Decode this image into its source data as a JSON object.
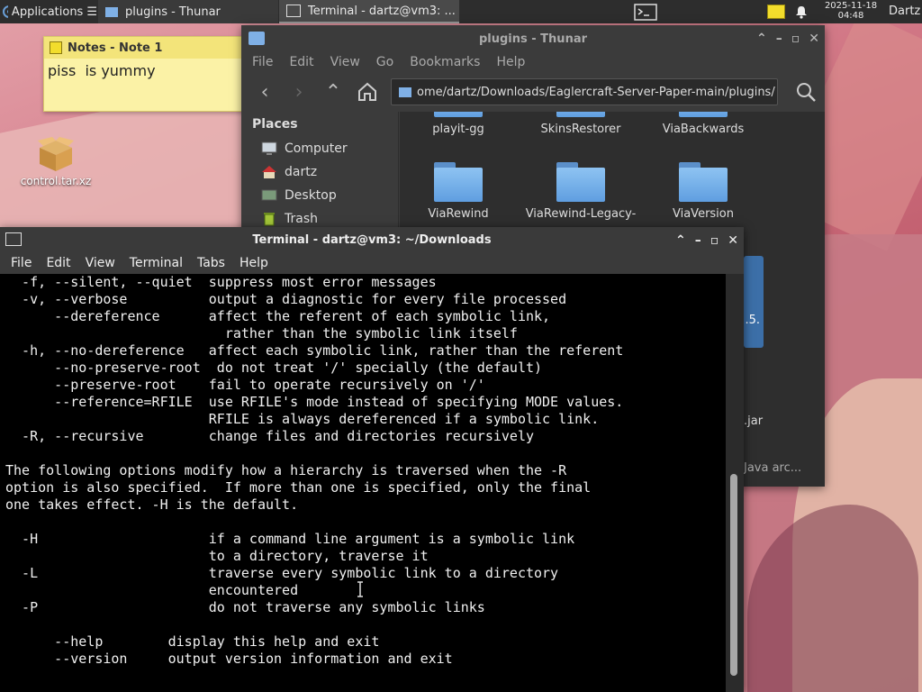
{
  "panel": {
    "apps_label": "Applications",
    "tasks": [
      {
        "label": "plugins - Thunar"
      },
      {
        "label": "Terminal - dartz@vm3: ..."
      }
    ],
    "clock_date": "2025-11-18",
    "clock_time": "04:48",
    "user": "Dartz"
  },
  "note": {
    "title": "Notes - Note 1",
    "body": "piss  is yummy"
  },
  "desktop_icons": [
    {
      "label": "control.tar.xz",
      "icon": "archive-icon"
    }
  ],
  "thunar": {
    "title": "plugins - Thunar",
    "menu": [
      "File",
      "Edit",
      "View",
      "Go",
      "Bookmarks",
      "Help"
    ],
    "path": "ome/dartz/Downloads/Eaglercraft-Server-Paper-main/plugins/",
    "places_header": "Places",
    "places": [
      {
        "label": "Computer",
        "icon": "computer-icon"
      },
      {
        "label": "dartz",
        "icon": "home-icon"
      },
      {
        "label": "Desktop",
        "icon": "desktop-icon"
      },
      {
        "label": "Trash",
        "icon": "trash-icon"
      }
    ],
    "files_row1": [
      "playit-gg",
      "SkinsRestorer",
      "ViaBackwards"
    ],
    "files_row2": [
      "ViaRewind",
      "ViaRewind-Legacy-",
      "ViaVersion"
    ],
    "partial_text": [
      ".5.",
      ".jar",
      "Java arc..."
    ]
  },
  "terminal": {
    "title": "Terminal - dartz@vm3: ~/Downloads",
    "menu": [
      "File",
      "Edit",
      "View",
      "Terminal",
      "Tabs",
      "Help"
    ],
    "lines": [
      "  -f, --silent, --quiet  suppress most error messages",
      "  -v, --verbose          output a diagnostic for every file processed",
      "      --dereference      affect the referent of each symbolic link,",
      "                           rather than the symbolic link itself",
      "  -h, --no-dereference   affect each symbolic link, rather than the referent",
      "      --no-preserve-root  do not treat '/' specially (the default)",
      "      --preserve-root    fail to operate recursively on '/'",
      "      --reference=RFILE  use RFILE's mode instead of specifying MODE values.",
      "                         RFILE is always dereferenced if a symbolic link.",
      "  -R, --recursive        change files and directories recursively",
      "",
      "The following options modify how a hierarchy is traversed when the -R",
      "option is also specified.  If more than one is specified, only the final",
      "one takes effect. -H is the default.",
      "",
      "  -H                     if a command line argument is a symbolic link",
      "                         to a directory, traverse it",
      "  -L                     traverse every symbolic link to a directory",
      "                         encountered",
      "  -P                     do not traverse any symbolic links",
      "",
      "      --help        display this help and exit",
      "      --version     output version information and exit",
      ""
    ]
  },
  "colors": {
    "panel_bg": "#2d2d2d",
    "thunar_bg": "#3b3b3b",
    "terminal_bg": "#000000",
    "terminal_fg": "#f0f0f0",
    "note_bg": "#fbf2a6",
    "folder_blue": "#6fa8e8"
  }
}
